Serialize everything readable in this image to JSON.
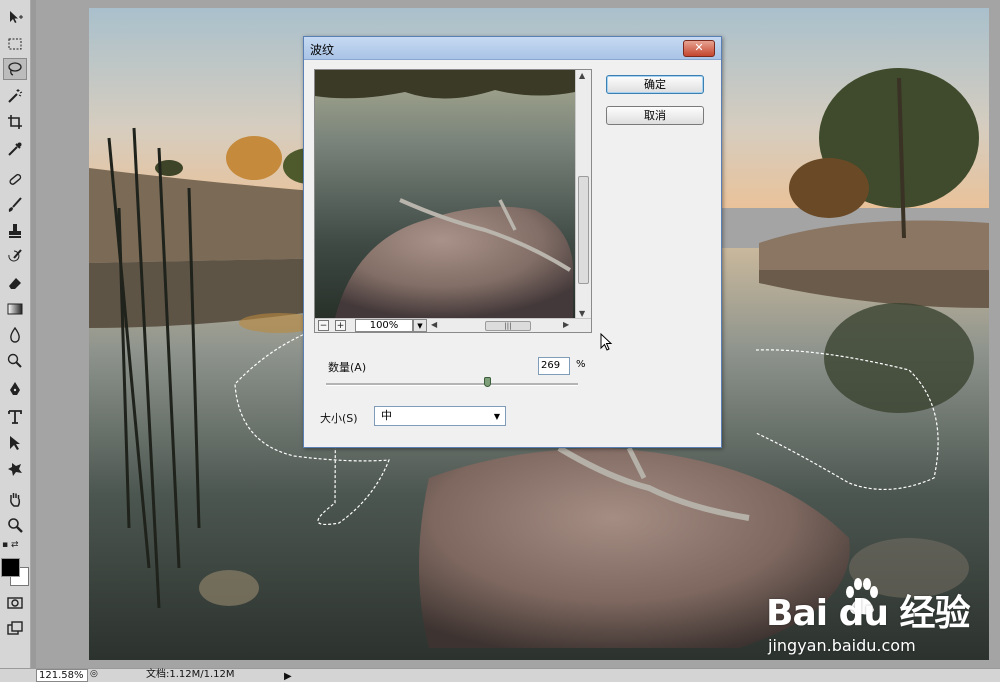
{
  "dialog": {
    "title": "波纹",
    "ok_label": "确定",
    "cancel_label": "取消",
    "zoom_value": "100%",
    "zoom_minus": "−",
    "zoom_plus": "+",
    "amount_label": "数量(A)",
    "amount_value": "269",
    "amount_unit": "%",
    "amount_slider_fraction": 0.64,
    "size_label": "大小(S)",
    "size_value": "中"
  },
  "statusbar": {
    "zoom": "121.58%",
    "doc_info": "文档:1.12M/1.12M"
  },
  "watermark": {
    "brand": "Bai du 经验",
    "site": "jingyan.baidu.com"
  },
  "icons": [
    "move-icon",
    "marquee-icon",
    "lasso-icon",
    "magic-wand-icon",
    "crop-icon",
    "eyedropper-icon",
    "healing-brush-icon",
    "brush-icon",
    "clone-stamp-icon",
    "history-brush-icon",
    "eraser-icon",
    "gradient-icon",
    "blur-icon",
    "dodge-icon",
    "pen-icon",
    "type-icon",
    "path-select-icon",
    "shape-icon",
    "hand-icon",
    "zoom-icon"
  ],
  "colors": {
    "foreground": "#000000",
    "background": "#ffffff"
  }
}
